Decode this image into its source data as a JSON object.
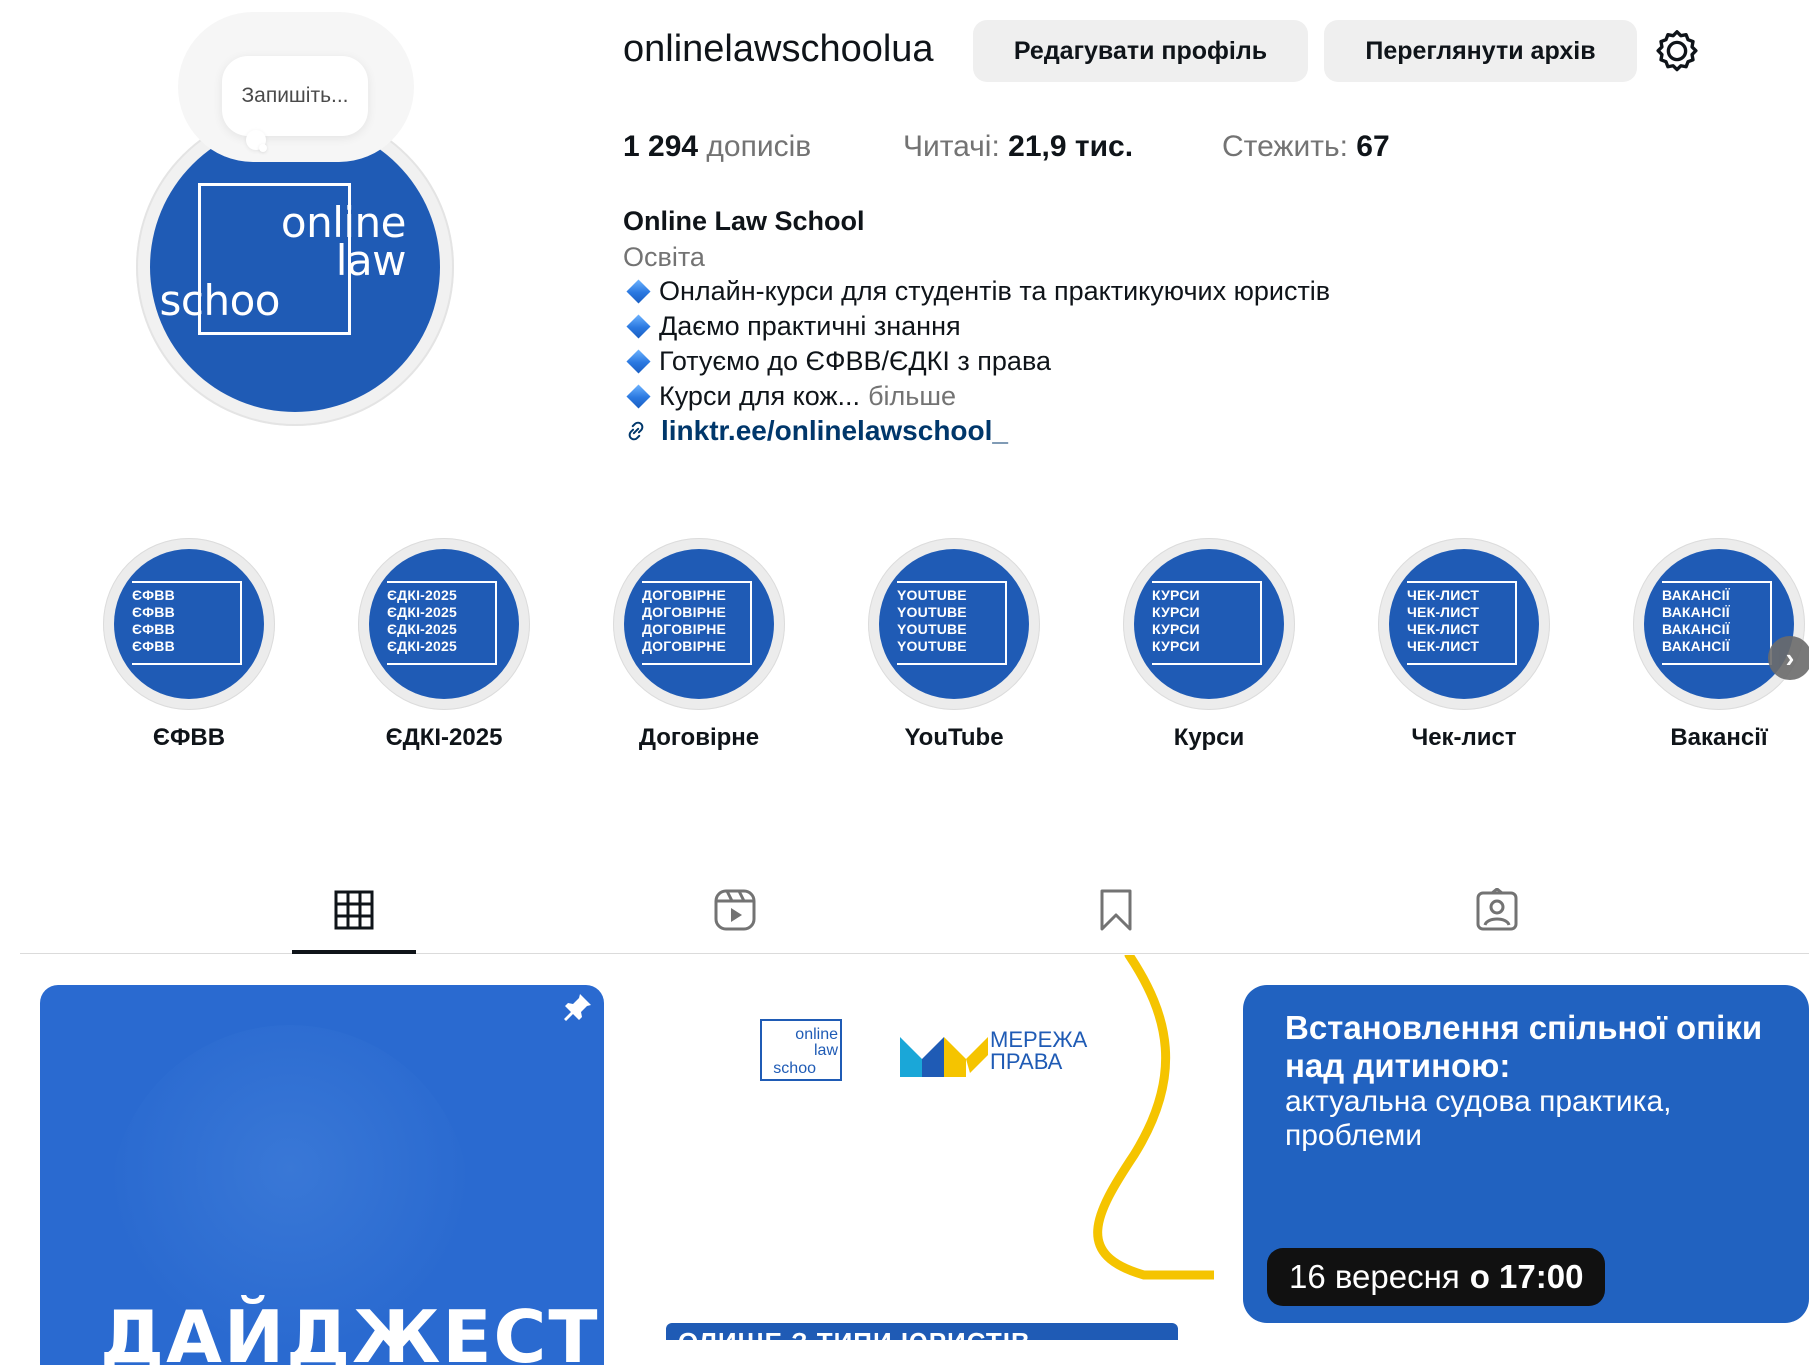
{
  "profile": {
    "username": "onlinelawschoolua",
    "note_placeholder": "Запишіть...",
    "avatar_words": [
      "online",
      "law",
      "schoo"
    ],
    "edit_button": "Редагувати профіль",
    "archive_button": "Переглянути архів",
    "icons": {
      "settings": "gear-icon",
      "link": "link-icon"
    }
  },
  "stats": {
    "posts_count": "1 294",
    "posts_label": "дописів",
    "followers_label": "Читачі:",
    "followers_count": "21,9 тис.",
    "following_label": "Стежить:",
    "following_count": "67"
  },
  "bio": {
    "name": "Online Law School",
    "category": "Освіта",
    "lines": [
      "Онлайн-курси для студентів та практикуючих юристів",
      "Даємо практичні знання",
      "Готуємо до ЄФВВ/ЄДКІ з права",
      "Курси для кож..."
    ],
    "more": "більше",
    "link": "linktr.ee/onlinelawschool_"
  },
  "highlights": [
    {
      "label": "ЄФВВ",
      "cover": "ЄФВВ"
    },
    {
      "label": "ЄДКІ-2025",
      "cover": "ЄДКІ-2025"
    },
    {
      "label": "Договірне",
      "cover": "ДОГОВІРНЕ"
    },
    {
      "label": "YouTube",
      "cover": "YOUTUBE"
    },
    {
      "label": "Курси",
      "cover": "КУРСИ"
    },
    {
      "label": "Чек-лист",
      "cover": "ЧЕК-ЛИСТ"
    },
    {
      "label": "Вакансії",
      "cover": "ВАКАНСІЇ"
    }
  ],
  "tabs": [
    {
      "name": "posts",
      "icon": "grid-icon",
      "active": true
    },
    {
      "name": "reels",
      "icon": "reels-icon",
      "active": false
    },
    {
      "name": "saved",
      "icon": "bookmark-icon",
      "active": false
    },
    {
      "name": "tagged",
      "icon": "tagged-icon",
      "active": false
    }
  ],
  "posts": {
    "post1": {
      "title": "ДАЙДЖЕСТ"
    },
    "post2": {
      "logo_words": [
        "online",
        "law",
        "schoo"
      ],
      "partner_line1": "МЕРЕЖА",
      "partner_line2": "ПРАВА",
      "bottom_text": "ОЛИШЕ З ТИПИ ЮРИСТІВ"
    },
    "post3": {
      "title": "Встановлення спільної опіки над дитиною:",
      "subtitle": "актуальна судова практика, проблеми",
      "date": "16 вересня",
      "time": "о 17:00"
    }
  },
  "colors": {
    "brand_blue": "#1f5bb5",
    "button_bg": "#efefef",
    "link": "#00376b",
    "muted": "#737373",
    "accent_yellow": "#f5c400"
  }
}
